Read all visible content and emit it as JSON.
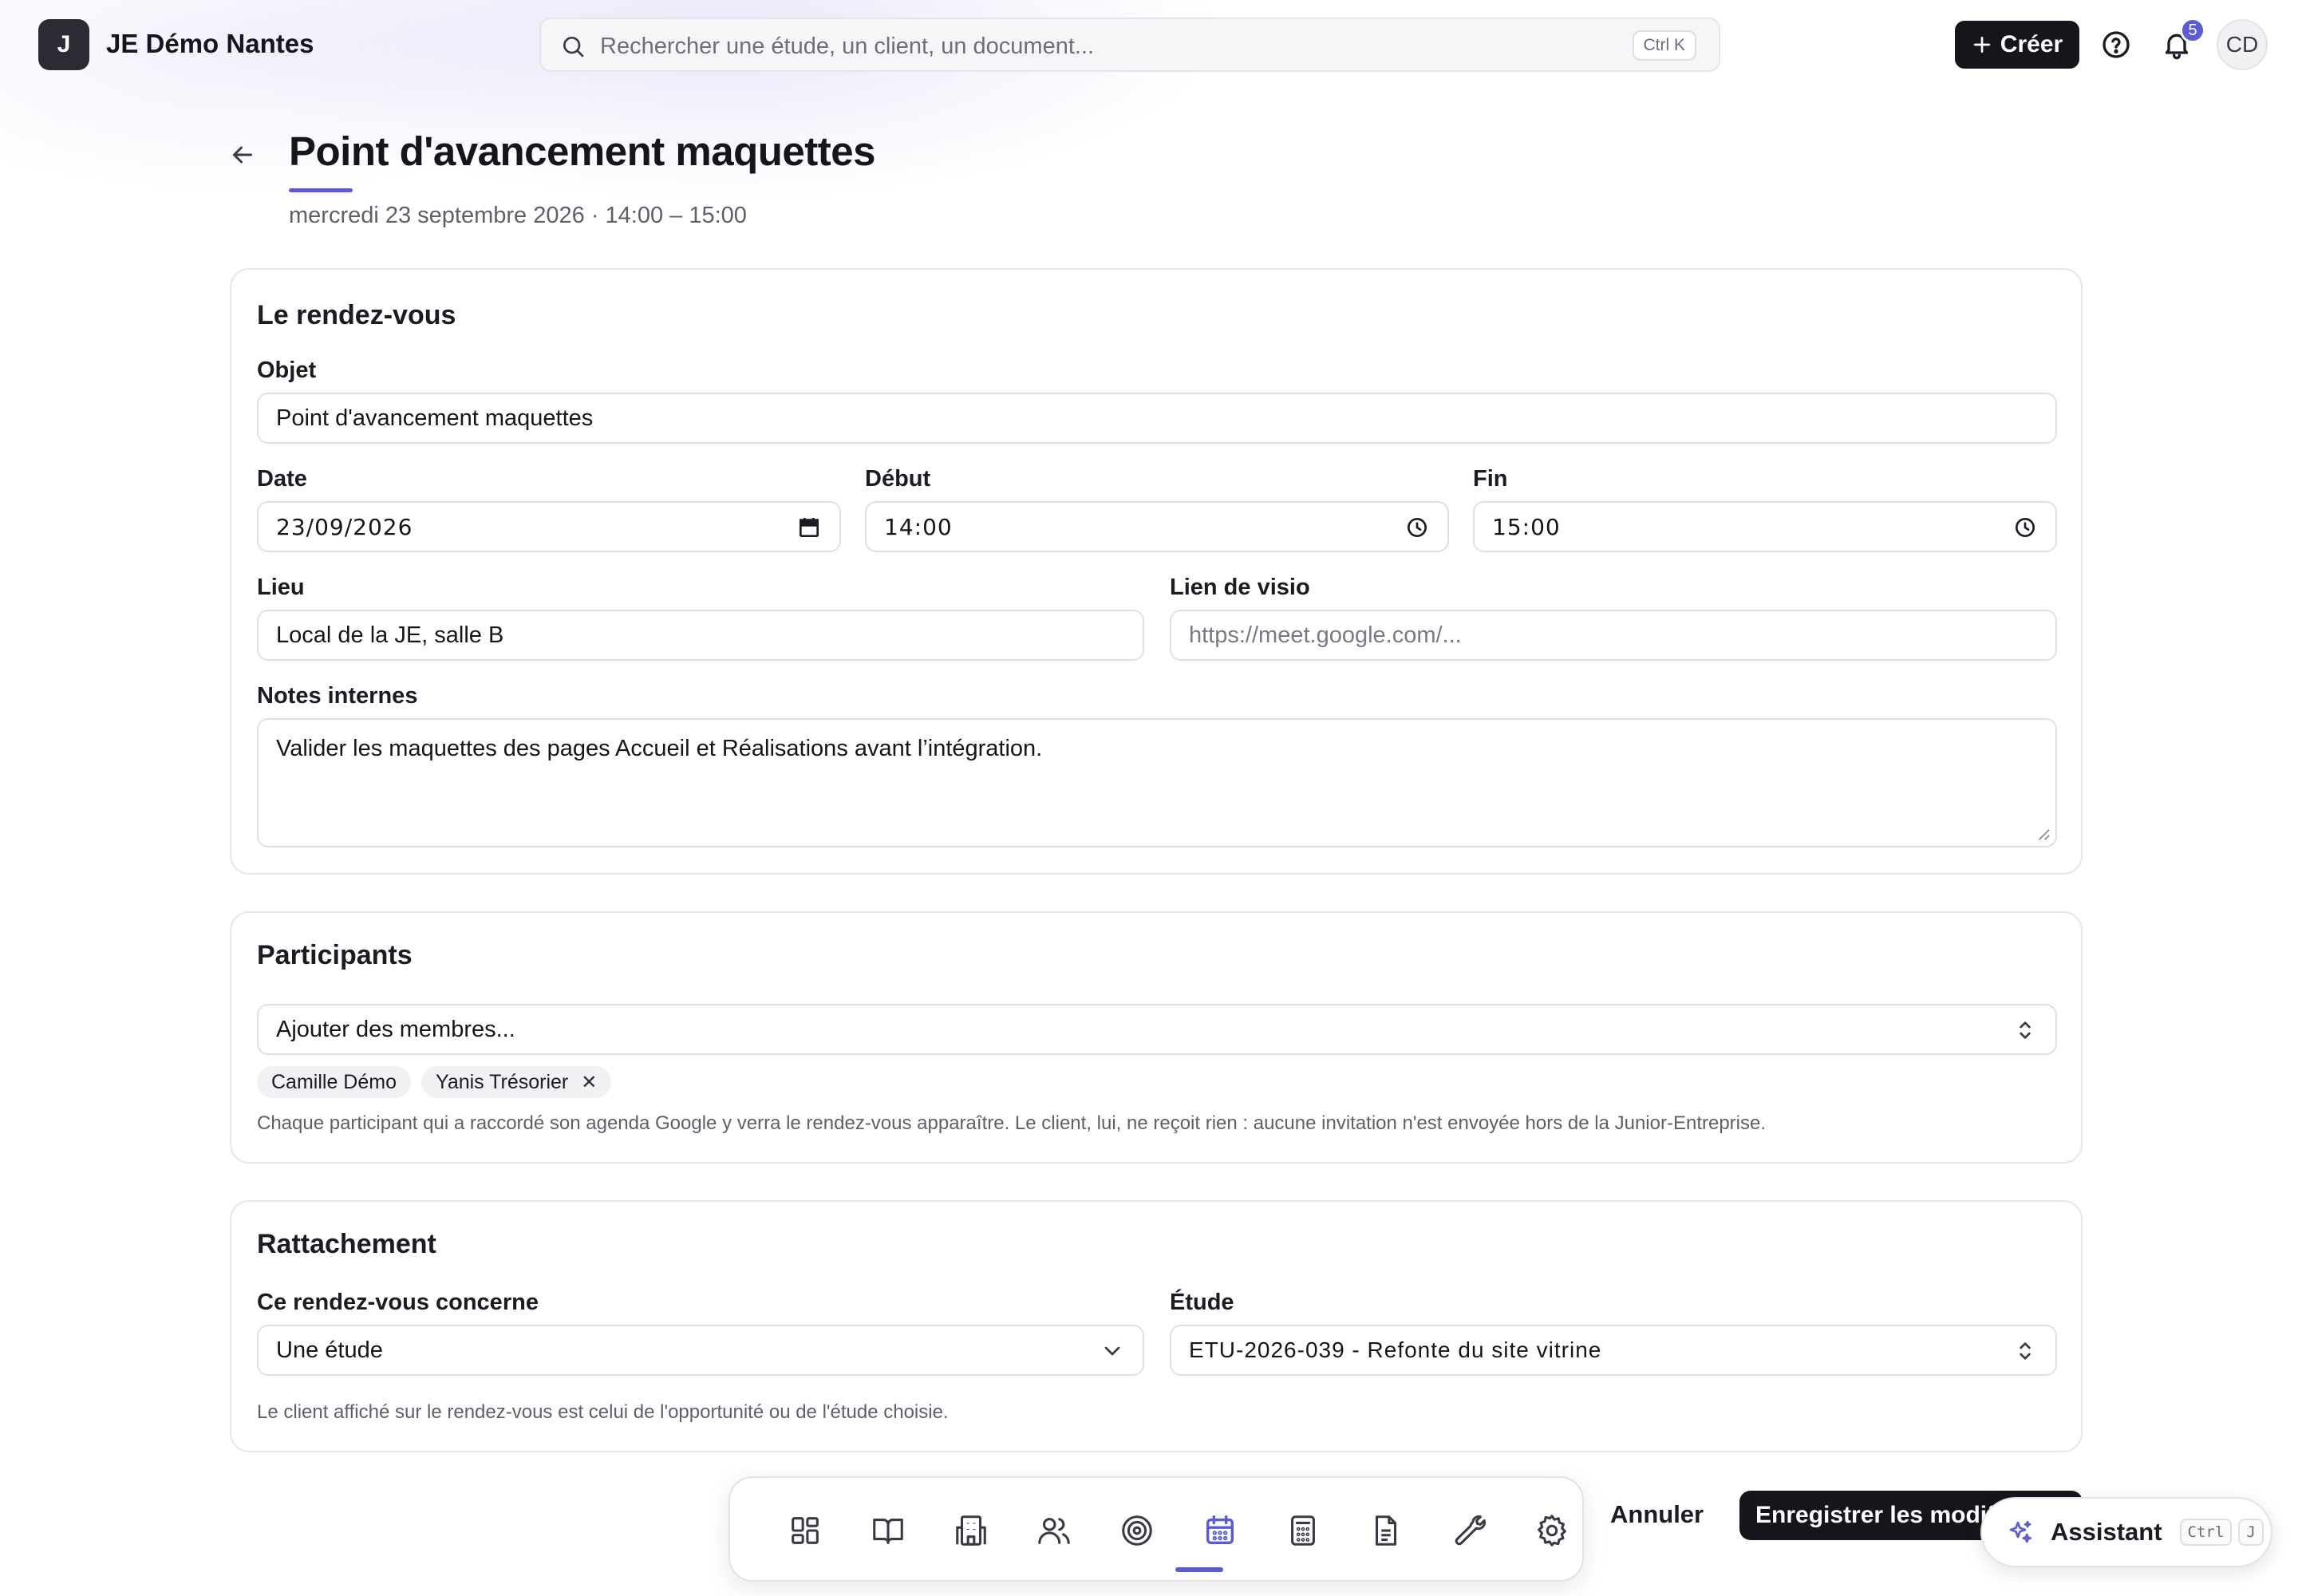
{
  "topbar": {
    "logo_letter": "J",
    "org_name": "JE Démo Nantes",
    "search_placeholder": "Rechercher une étude, un client, un document...",
    "search_shortcut": "Ctrl K",
    "create_label": "Créer",
    "notifications_count": "5",
    "avatar_initials": "CD"
  },
  "header": {
    "title": "Point d'avancement maquettes",
    "subtitle": "mercredi 23 septembre 2026 · 14:00 – 15:00"
  },
  "rdv": {
    "section_title": "Le rendez-vous",
    "objet_label": "Objet",
    "objet_value": "Point d'avancement maquettes",
    "date_label": "Date",
    "date_value": "23/09/2026",
    "debut_label": "Début",
    "debut_value": "14:00",
    "fin_label": "Fin",
    "fin_value": "15:00",
    "lieu_label": "Lieu",
    "lieu_value": "Local de la JE, salle B",
    "visio_label": "Lien de visio",
    "visio_placeholder": "https://meet.google.com/...",
    "notes_label": "Notes internes",
    "notes_value": "Valider les maquettes des pages Accueil et Réalisations avant l’intégration."
  },
  "participants": {
    "section_title": "Participants",
    "add_placeholder": "Ajouter des membres...",
    "chips": [
      "Camille Démo",
      "Yanis Trésorier"
    ],
    "helper": "Chaque participant qui a raccordé son agenda Google y verra le rendez-vous apparaître. Le client, lui, ne reçoit rien : aucune invitation n'est envoyée hors de la Junior-Entreprise."
  },
  "rattachement": {
    "section_title": "Rattachement",
    "concerne_label": "Ce rendez-vous concerne",
    "concerne_value": "Une étude",
    "etude_label": "Étude",
    "etude_value": "ETU-2026-039 - Refonte du site vitrine",
    "helper": "Le client affiché sur le rendez-vous est celui de l'opportunité ou de l'étude choisie."
  },
  "dock": {
    "items": [
      "dashboard-icon",
      "book-icon",
      "building-icon",
      "users-icon",
      "target-icon",
      "calendar-icon",
      "calculator-icon",
      "document-icon",
      "wrench-icon",
      "settings-icon"
    ],
    "active": "calendar-icon",
    "accent": "#5b5bd6"
  },
  "actions": {
    "cancel_label": "Annuler",
    "save_label": "Enregistrer les modifications"
  },
  "assistant": {
    "label": "Assistant",
    "key1": "Ctrl",
    "key2": "J"
  }
}
